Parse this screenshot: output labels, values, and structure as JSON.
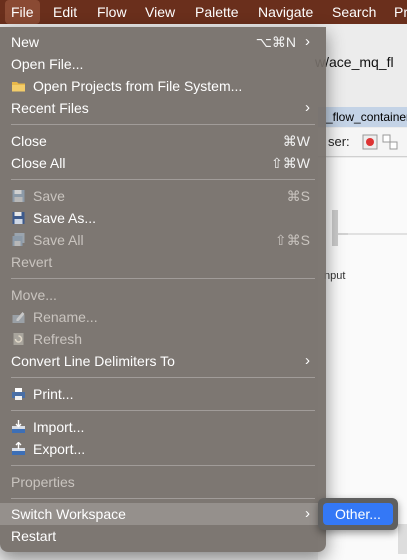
{
  "menubar": {
    "items": [
      {
        "label": "File",
        "active": true
      },
      {
        "label": "Edit"
      },
      {
        "label": "Flow"
      },
      {
        "label": "View"
      },
      {
        "label": "Palette"
      },
      {
        "label": "Navigate"
      },
      {
        "label": "Search"
      },
      {
        "label": "Pr"
      }
    ]
  },
  "background": {
    "path_text": "w/ace_mq_fl",
    "tab_text": "_flow_container",
    "toolbar_label": "ser:",
    "node_label": "nput"
  },
  "file_menu": {
    "items": {
      "new": {
        "label": "New",
        "shortcut": "⌥⌘N"
      },
      "open_file": {
        "label": "Open File..."
      },
      "open_projects": {
        "label": "Open Projects from File System...",
        "icon": "folder-icon"
      },
      "recent_files": {
        "label": "Recent Files"
      },
      "close": {
        "label": "Close",
        "shortcut": "⌘W"
      },
      "close_all": {
        "label": "Close All",
        "shortcut": "⇧⌘W"
      },
      "save": {
        "label": "Save",
        "shortcut": "⌘S",
        "disabled": true,
        "icon": "save-icon"
      },
      "save_as": {
        "label": "Save As...",
        "icon": "save-as-icon"
      },
      "save_all": {
        "label": "Save All",
        "shortcut": "⇧⌘S",
        "disabled": true,
        "icon": "save-all-icon"
      },
      "revert": {
        "label": "Revert",
        "disabled": true
      },
      "move": {
        "label": "Move...",
        "disabled": true
      },
      "rename": {
        "label": "Rename...",
        "disabled": true,
        "icon": "rename-icon"
      },
      "refresh": {
        "label": "Refresh",
        "disabled": true,
        "icon": "refresh-icon"
      },
      "convert_line_delimiters": {
        "label": "Convert Line Delimiters To"
      },
      "print": {
        "label": "Print...",
        "icon": "print-icon"
      },
      "import": {
        "label": "Import...",
        "icon": "import-icon"
      },
      "export": {
        "label": "Export...",
        "icon": "export-icon"
      },
      "properties": {
        "label": "Properties",
        "disabled": true
      },
      "switch_workspace": {
        "label": "Switch Workspace",
        "highlighted": true
      },
      "restart": {
        "label": "Restart"
      }
    }
  },
  "submenu": {
    "items": [
      {
        "label": "Other...",
        "selected": true
      }
    ]
  },
  "colors": {
    "menubar": "#6a2f1c",
    "menu_bg": "#746e68",
    "selection": "#3478f6"
  }
}
